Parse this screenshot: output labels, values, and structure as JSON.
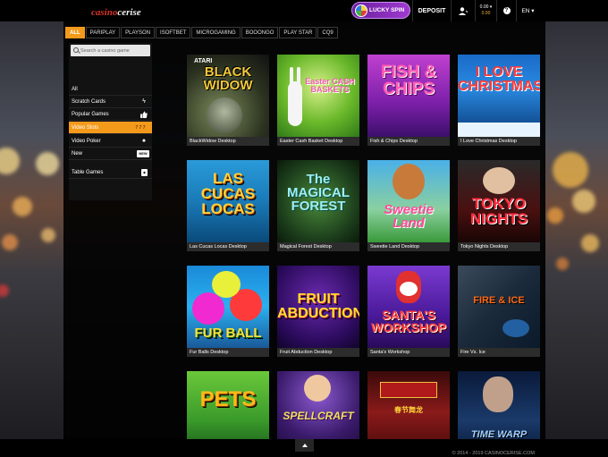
{
  "header": {
    "logo_part1": "casino",
    "logo_part2": "cerise",
    "lucky_spin": "LUCKY SPIN",
    "deposit": "DEPOSIT",
    "balance_top": "0.00 ▾",
    "balance_bottom": "0.00",
    "language": "EN ▾"
  },
  "providers": [
    "ALL",
    "PARIPLAY",
    "PLAYSON",
    "ISOFTBET",
    "MICROGAMING",
    "BOOONGO",
    "PLAY STAR",
    "CQ9"
  ],
  "search": {
    "placeholder": "Search a casino game"
  },
  "categories": [
    {
      "label": "All",
      "icon": ""
    },
    {
      "label": "Scratch Cards",
      "icon": "lightning-icon"
    },
    {
      "label": "Popular Games",
      "icon": "thumbs-up-icon"
    },
    {
      "label": "Video Slots",
      "icon": "777-icon"
    },
    {
      "label": "Video Poker",
      "icon": "spade-icon"
    },
    {
      "label": "New",
      "icon": "new-badge-icon"
    },
    {
      "label": "Table Games",
      "icon": "dice-icon"
    }
  ],
  "category_icon_text": {
    "slots": "7 7 7",
    "new": "NEW"
  },
  "games": [
    {
      "name": "BlackWidow Desktop",
      "title": "BLACK WIDOW",
      "tag": "ATARI"
    },
    {
      "name": "Easter Cash Basket Desktop",
      "title": "Easter CASH BASKETS"
    },
    {
      "name": "Fish & Chips Desktop",
      "title": "FISH & CHIPS"
    },
    {
      "name": "I Love Christmas Desktop",
      "title": "I LOVE CHRISTMAS"
    },
    {
      "name": "Las Cucas Locas Desktop",
      "title": "LAS CUCAS LOCAS"
    },
    {
      "name": "Magical Forest Desktop",
      "title": "The MAGICAL FOREST"
    },
    {
      "name": "Sweetie Land Desktop",
      "title": "Sweetie Land"
    },
    {
      "name": "Tokyo Nights Desktop",
      "title": "TOKYO NIGHTS"
    },
    {
      "name": "Fur Balls Desktop",
      "title": "FUR BALL"
    },
    {
      "name": "Fruit Abduction Desktop",
      "title": "FRUIT ABDUCTION"
    },
    {
      "name": "Santa's Workshop",
      "title": "SANTA'S WORKSHOP"
    },
    {
      "name": "Fire Vs. Ice",
      "title": "FIRE & ICE"
    },
    {
      "name": "",
      "title": "PETS"
    },
    {
      "name": "",
      "title": "SPELLCRAFT"
    },
    {
      "name": "",
      "title": "春节舞龙"
    },
    {
      "name": "",
      "title": "TIME WARP"
    }
  ],
  "footer": {
    "copyright": "© 2014 - 2019 CASINOCERISE.COM"
  },
  "colors": {
    "accent": "#f39a1b",
    "topbar": "#000000",
    "lucky_spin": "#8a2fc0"
  }
}
